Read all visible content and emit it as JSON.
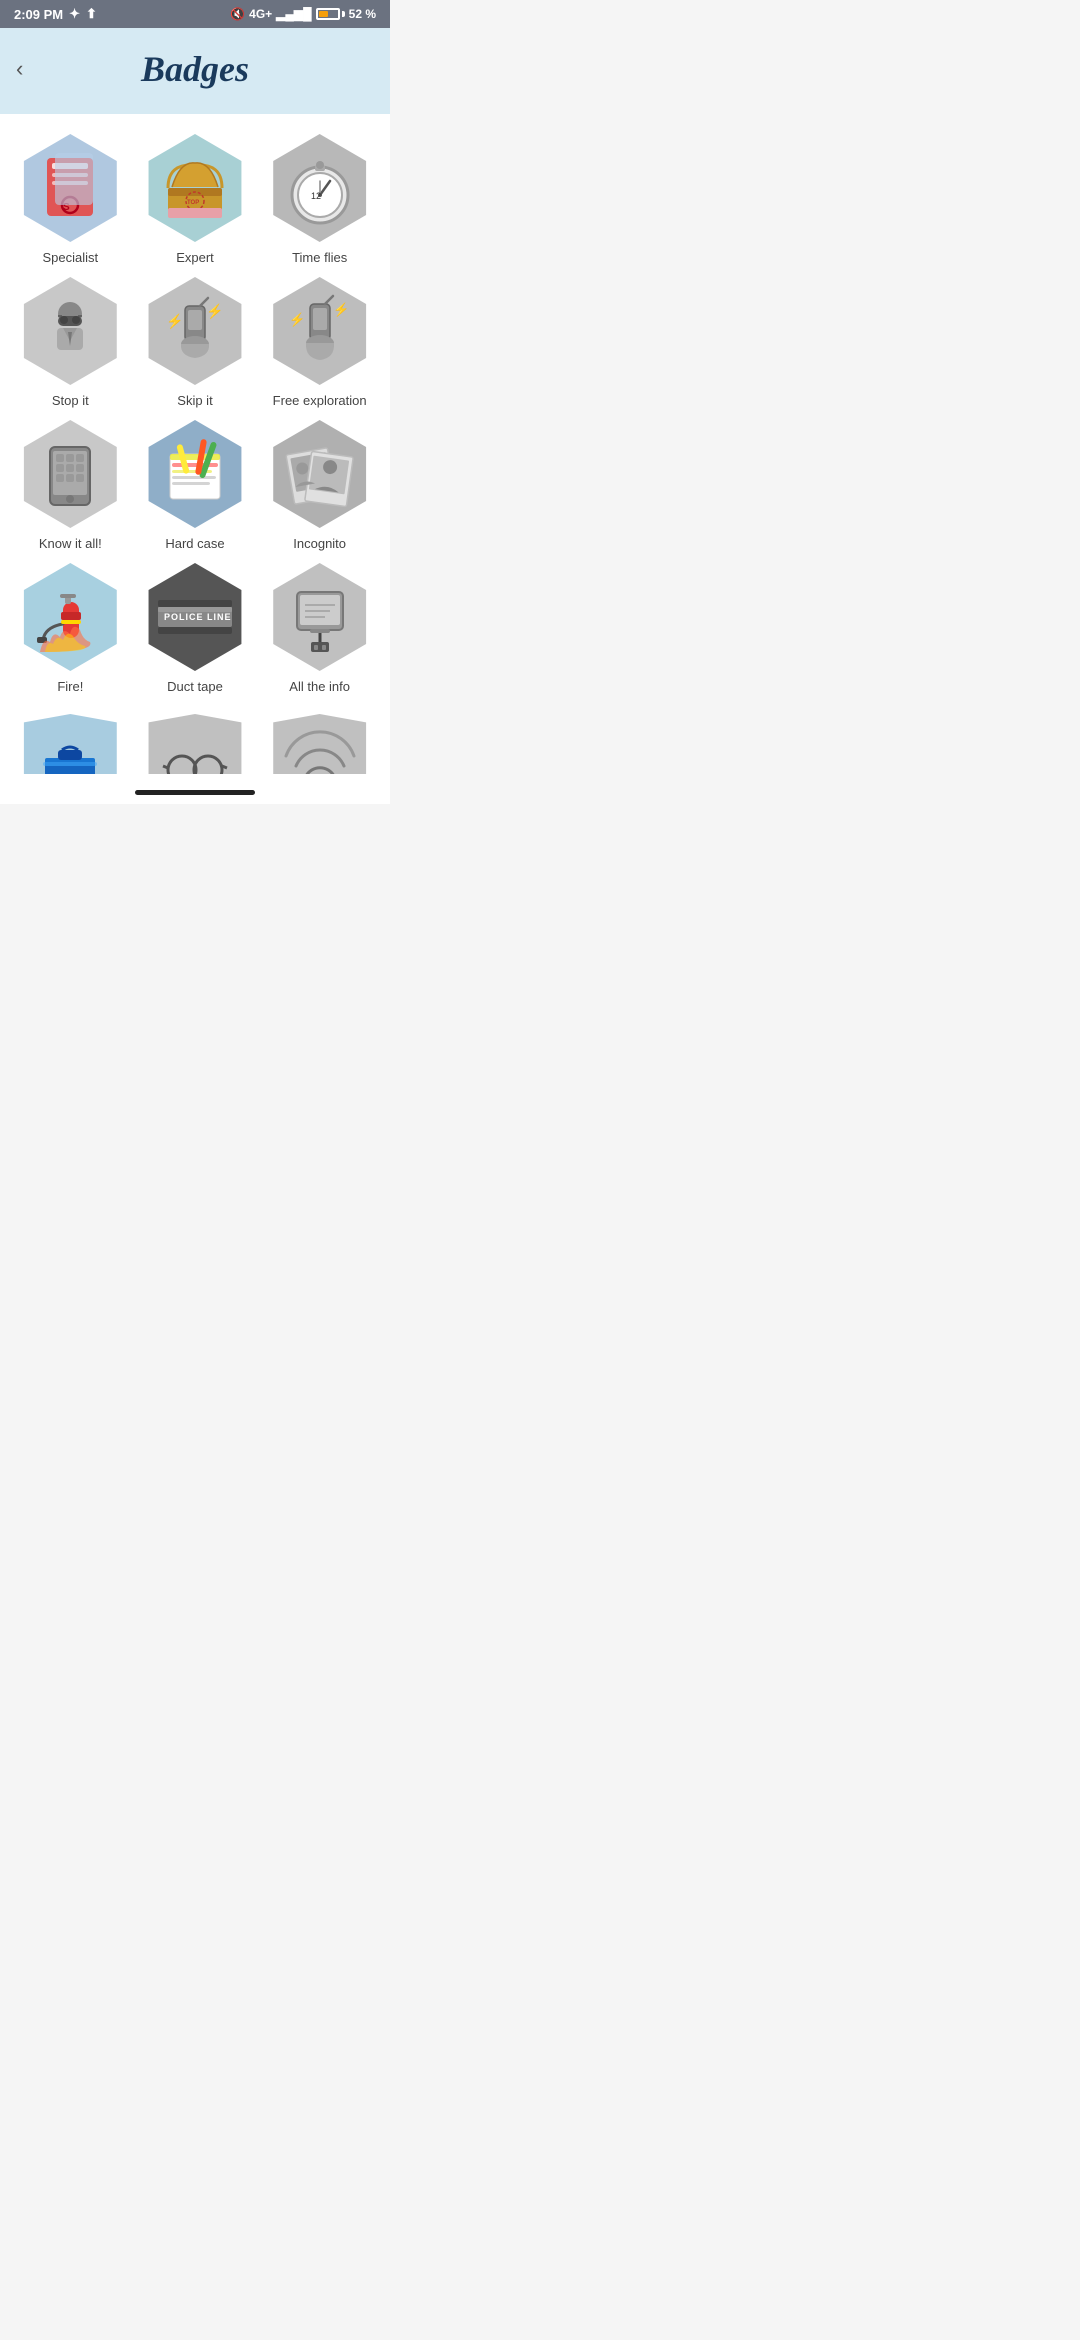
{
  "statusBar": {
    "time": "2:09 PM",
    "battery": "52 %"
  },
  "header": {
    "title": "Badges",
    "backLabel": "‹"
  },
  "badges": [
    {
      "id": "specialist",
      "label": "Specialist",
      "color": "blue",
      "emoji": "📋"
    },
    {
      "id": "expert",
      "label": "Expert",
      "color": "teal",
      "emoji": "📦"
    },
    {
      "id": "time-flies",
      "label": "Time flies",
      "color": "gray",
      "emoji": "⏱"
    },
    {
      "id": "stop-it",
      "label": "Stop it",
      "color": "lgray",
      "emoji": "🕵"
    },
    {
      "id": "skip-it",
      "label": "Skip it",
      "color": "lgray",
      "emoji": "📡"
    },
    {
      "id": "free-exploration",
      "label": "Free exploration",
      "color": "lgray",
      "emoji": "📡"
    },
    {
      "id": "know-it-all",
      "label": "Know it all!",
      "color": "lgray",
      "emoji": "📱"
    },
    {
      "id": "hard-case",
      "label": "Hard case",
      "color": "blue2",
      "emoji": "📝"
    },
    {
      "id": "incognito",
      "label": "Incognito",
      "color": "lgray",
      "emoji": "🖼"
    },
    {
      "id": "fire",
      "label": "Fire!",
      "color": "lblue",
      "emoji": "🧯"
    },
    {
      "id": "duct-tape",
      "label": "Duct tape",
      "color": "dkgray",
      "emoji": "🚧"
    },
    {
      "id": "all-the-info",
      "label": "All the info",
      "color": "lgray",
      "emoji": "🔌"
    }
  ]
}
